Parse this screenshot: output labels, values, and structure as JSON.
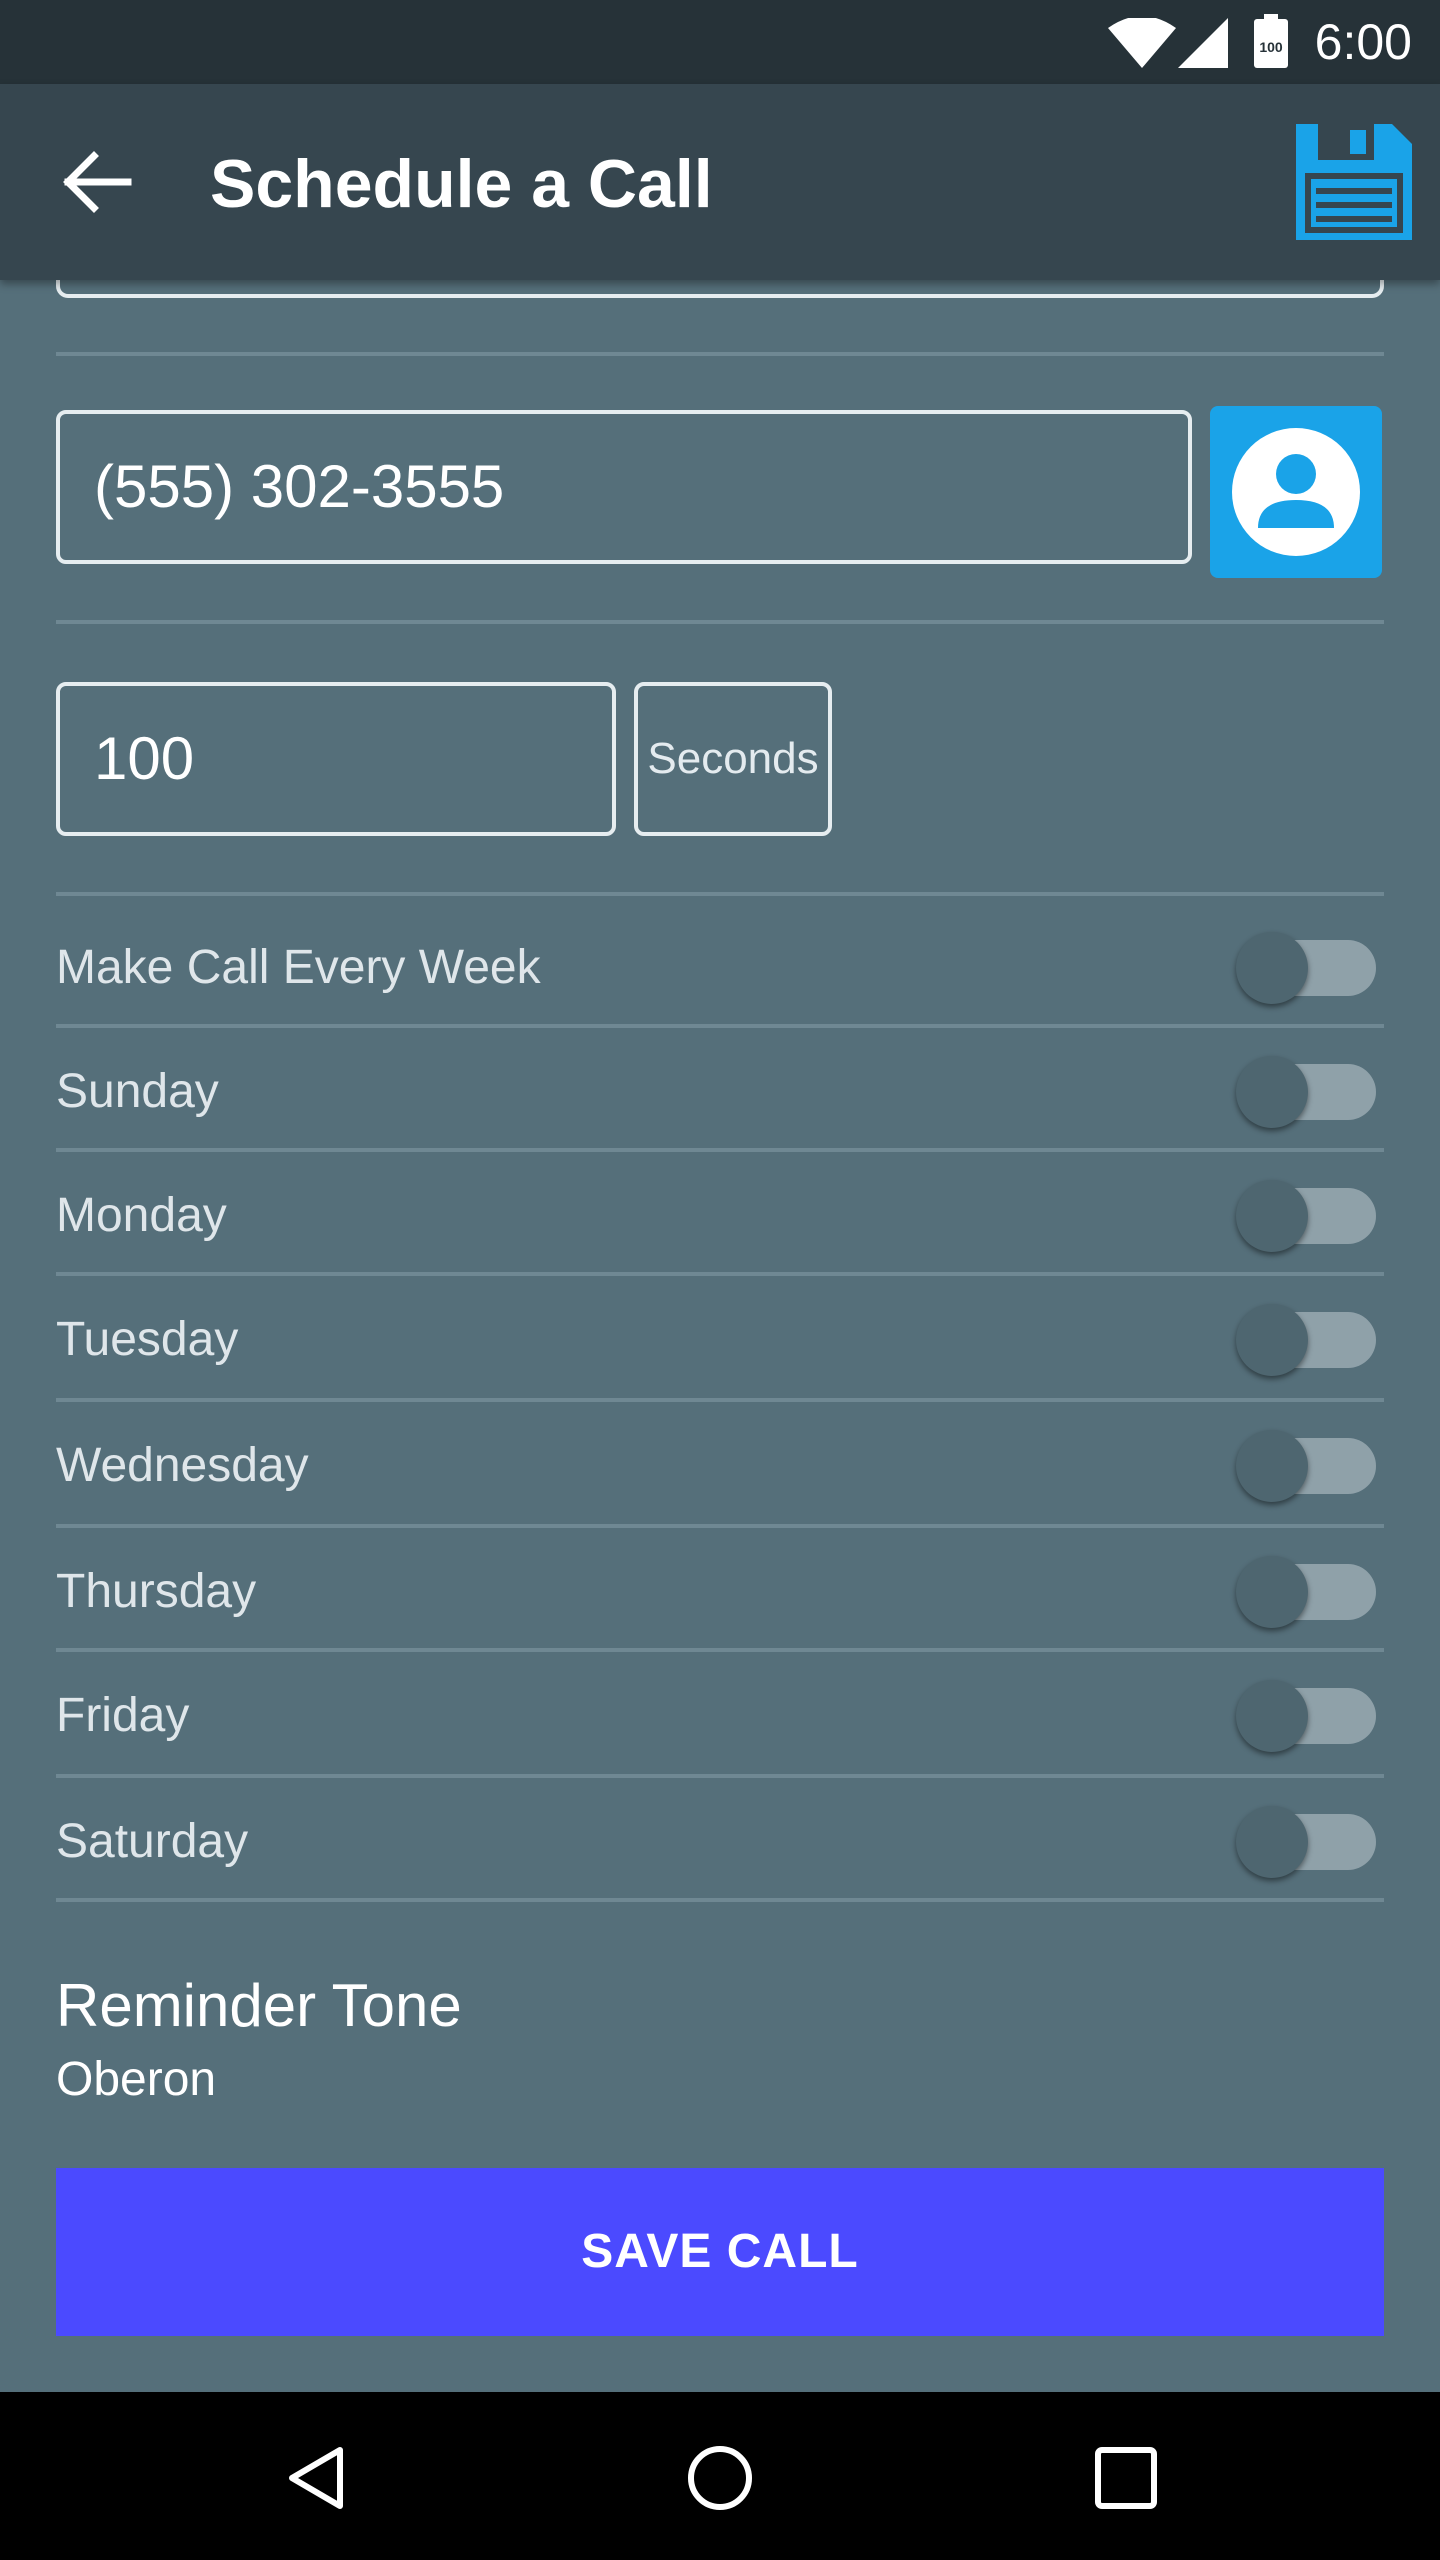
{
  "status_bar": {
    "time": "6:00",
    "battery_label": "100",
    "icons": [
      "wifi-icon",
      "signal-icon",
      "battery-icon"
    ]
  },
  "app_bar": {
    "title": "Schedule a Call",
    "back_icon": "arrow-back-icon",
    "save_icon": "floppy-disk-icon"
  },
  "form": {
    "phone_value": "(555) 302-3555",
    "contact_icon": "contact-person-icon",
    "duration_value": "100",
    "duration_unit": "Seconds"
  },
  "toggles": [
    {
      "label": "Make Call Every Week",
      "on": false
    },
    {
      "label": "Sunday",
      "on": false
    },
    {
      "label": "Monday",
      "on": false
    },
    {
      "label": "Tuesday",
      "on": false
    },
    {
      "label": "Wednesday",
      "on": false
    },
    {
      "label": "Thursday",
      "on": false
    },
    {
      "label": "Friday",
      "on": false
    },
    {
      "label": "Saturday",
      "on": false
    }
  ],
  "reminder": {
    "title": "Reminder Tone",
    "value": "Oberon"
  },
  "actions": {
    "save_call_label": "SAVE CALL"
  },
  "colors": {
    "background": "#556f7a",
    "app_bar": "#36464f",
    "status_bar": "#263238",
    "accent_blue": "#1aa3e8",
    "save_button": "#4b4aff"
  }
}
